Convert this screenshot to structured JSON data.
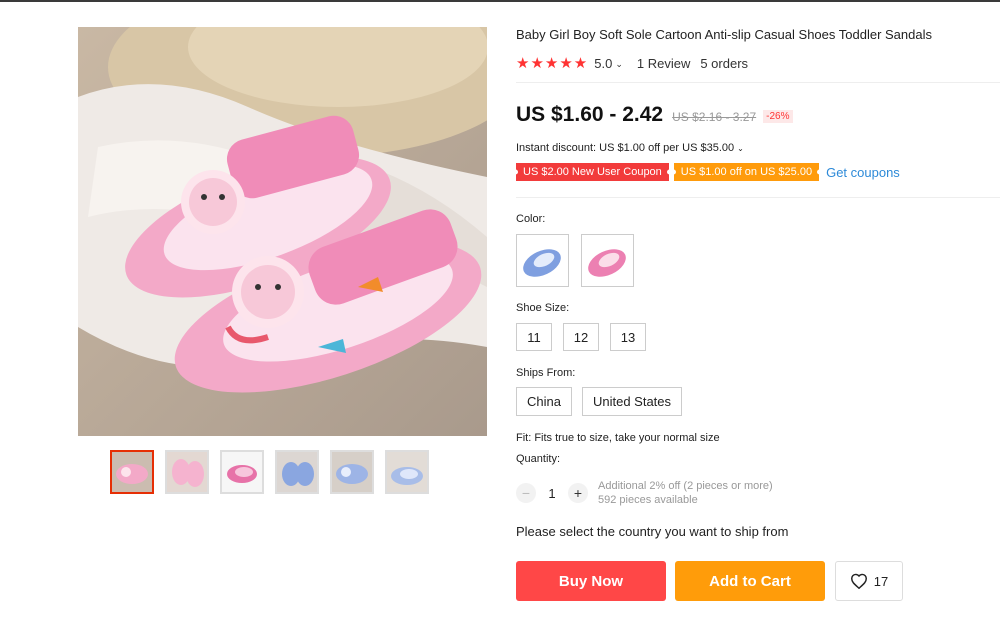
{
  "product": {
    "title": "Baby Girl Boy Soft Sole Cartoon Anti-slip Casual Shoes Toddler Sandals",
    "stars": "★★★★★",
    "rating": "5.0",
    "reviews": "1 Review",
    "orders": "5 orders"
  },
  "price": {
    "current": "US $1.60 - 2.42",
    "original": "US $2.16 - 3.27",
    "discount": "-26%"
  },
  "discounts": {
    "instant": "Instant discount: US $1.00 off per US $35.00",
    "coupon_new_user": "US $2.00 New User Coupon",
    "coupon_store": "US $1.00 off on US $25.00",
    "get_coupons": "Get coupons"
  },
  "options": {
    "color_label": "Color:",
    "colors": [
      "blue",
      "pink"
    ],
    "size_label": "Shoe Size:",
    "sizes": [
      "11",
      "12",
      "13"
    ],
    "ships_from_label": "Ships From:",
    "ships_from": [
      "China",
      "United States"
    ]
  },
  "fit": "Fit: Fits true to size, take your normal size",
  "quantity": {
    "label": "Quantity:",
    "value": "1",
    "minus": "−",
    "plus": "+",
    "note_line1": "Additional 2% off (2 pieces or more)",
    "note_line2": "592 pieces available"
  },
  "ship_prompt": "Please select the country you want to ship from",
  "actions": {
    "buy_now": "Buy Now",
    "add_to_cart": "Add to Cart",
    "wishlist_count": "17"
  },
  "gallery": {
    "thumbnails": [
      "pink-pair",
      "pink-side",
      "pink-single",
      "blue-pair",
      "blue-front",
      "blue-side"
    ],
    "active_index": 0
  },
  "colors": {
    "buy_now": "#ff4747",
    "add_to_cart": "#ff9c0a",
    "coupon_red": "#f23b3b",
    "coupon_orange": "#ff9b0b",
    "link": "#2d8ad8",
    "stars": "#ff3333"
  }
}
